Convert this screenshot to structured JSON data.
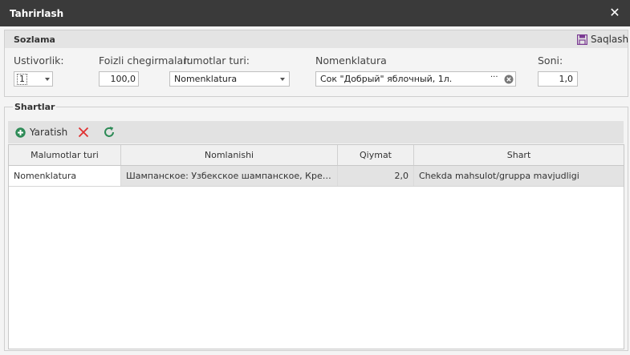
{
  "window": {
    "title": "Tahrirlash",
    "close_glyph": "✕"
  },
  "settings": {
    "title": "Sozlama",
    "save_label": "Saqlash",
    "priority_label": "Ustivorlik:",
    "priority_value": "1",
    "discount_label": "Foizli chegirmalar:",
    "discount_value": "100,0",
    "datatype_label": "lumotlar turi:",
    "datatype_value": "Nomenklatura",
    "nomenclature_label": "Nomenklatura",
    "nomenclature_value": "Сок \"Добрый\" яблочный, 1л.",
    "ellipsis": "···",
    "count_label": "Soni:",
    "count_value": "1,0"
  },
  "conditions": {
    "title": "Shartlar",
    "create_label": "Yaratish",
    "columns": [
      "Malumotlar turi",
      "Nomlanishi",
      "Qiymat",
      "Shart"
    ],
    "rows": [
      {
        "type": "Nomenklatura",
        "name": "Шампанское: Узбекское шампанское, Крепость",
        "value": "2,0",
        "condition": "Chekda mahsulot/gruppa mavjudligi"
      }
    ]
  },
  "colors": {
    "titlebar": "#3a3a3a",
    "save_icon": "#7b3a93",
    "create_icon": "#2e8b57",
    "delete_icon": "#e03030",
    "refresh_icon": "#2e8b57"
  },
  "icons": [
    "close-icon",
    "save-icon",
    "dropdown-arrow-icon",
    "ellipsis-icon",
    "clear-icon",
    "add-icon",
    "delete-icon",
    "refresh-icon"
  ]
}
